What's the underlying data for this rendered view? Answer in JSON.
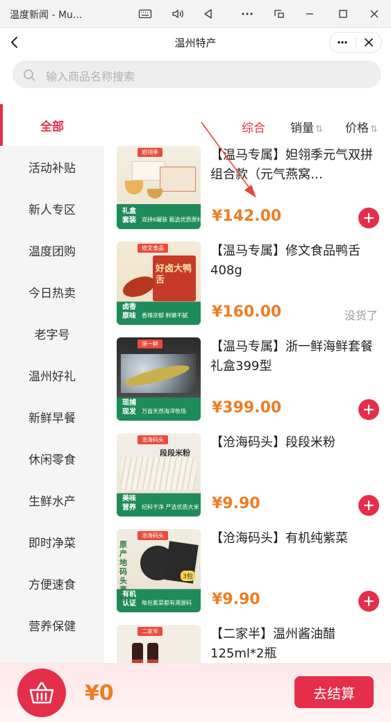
{
  "window": {
    "title": "温度新闻 - Mu..."
  },
  "header": {
    "title": "温州特产"
  },
  "search": {
    "placeholder": "输入商品名称搜索"
  },
  "categories": [
    {
      "label": "全部",
      "active": true
    },
    {
      "label": "活动补贴"
    },
    {
      "label": "新人专区"
    },
    {
      "label": "温度团购"
    },
    {
      "label": "今日热卖"
    },
    {
      "label": "老字号"
    },
    {
      "label": "温州好礼"
    },
    {
      "label": "新鲜早餐"
    },
    {
      "label": "休闲零食"
    },
    {
      "label": "生鲜水产"
    },
    {
      "label": "即时净菜"
    },
    {
      "label": "方便速食"
    },
    {
      "label": "营养保健"
    }
  ],
  "sort": {
    "default_label": "综合",
    "sales_label": "销量",
    "price_label": "价格",
    "sort_glyph": "⇅"
  },
  "products": [
    {
      "name": "【温马专属】妲翎季元气双拼组合款（元气燕窝…",
      "price": "¥142.00",
      "action": "add",
      "thumb": {
        "brand": "妲翎季",
        "tag": "礼盒套装",
        "slogan": "双拼6罐装 甄选优质原材"
      }
    },
    {
      "name": "【温马专属】修文食品鸭舌408g",
      "price": "¥160.00",
      "action": "sold_out",
      "status": "没货了",
      "thumb": {
        "brand": "修文食品",
        "tag": "卤香原味",
        "slogan": "香辣浓郁 鲜嫩不腻",
        "title": "好卤大鸭舌"
      }
    },
    {
      "name": "【温马专属】浙一鲜海鲜套餐礼盒399型",
      "price": "¥399.00",
      "action": "add",
      "thumb": {
        "brand": "浙一鲜",
        "tag": "现捕现发",
        "slogan": "万亩天然海洋牧场"
      }
    },
    {
      "name": "【沧海码头】段段米粉",
      "price": "¥9.90",
      "action": "add",
      "thumb": {
        "brand": "沧海码头",
        "tag": "美味营养",
        "slogan": "纪料干净 严选优质大米",
        "title": "段段米粉"
      }
    },
    {
      "name": "【沧海码头】有机纯紫菜",
      "price": "¥9.90",
      "action": "add",
      "thumb": {
        "brand": "沧海码头",
        "tag": "有机认证",
        "slogan": "每包紫菜都有溯源码",
        "title": "原产地码头直供",
        "badge": "3包"
      }
    },
    {
      "name": "【二家半】温州酱油醋125ml*2瓶",
      "price": "",
      "action": "none",
      "thumb": {
        "brand": "二家半"
      }
    }
  ],
  "cart": {
    "total": "¥0",
    "checkout_label": "去结算"
  },
  "colors": {
    "accent": "#e42e4a",
    "price": "#f07c22",
    "thumb_green": "#1f8a5a"
  }
}
